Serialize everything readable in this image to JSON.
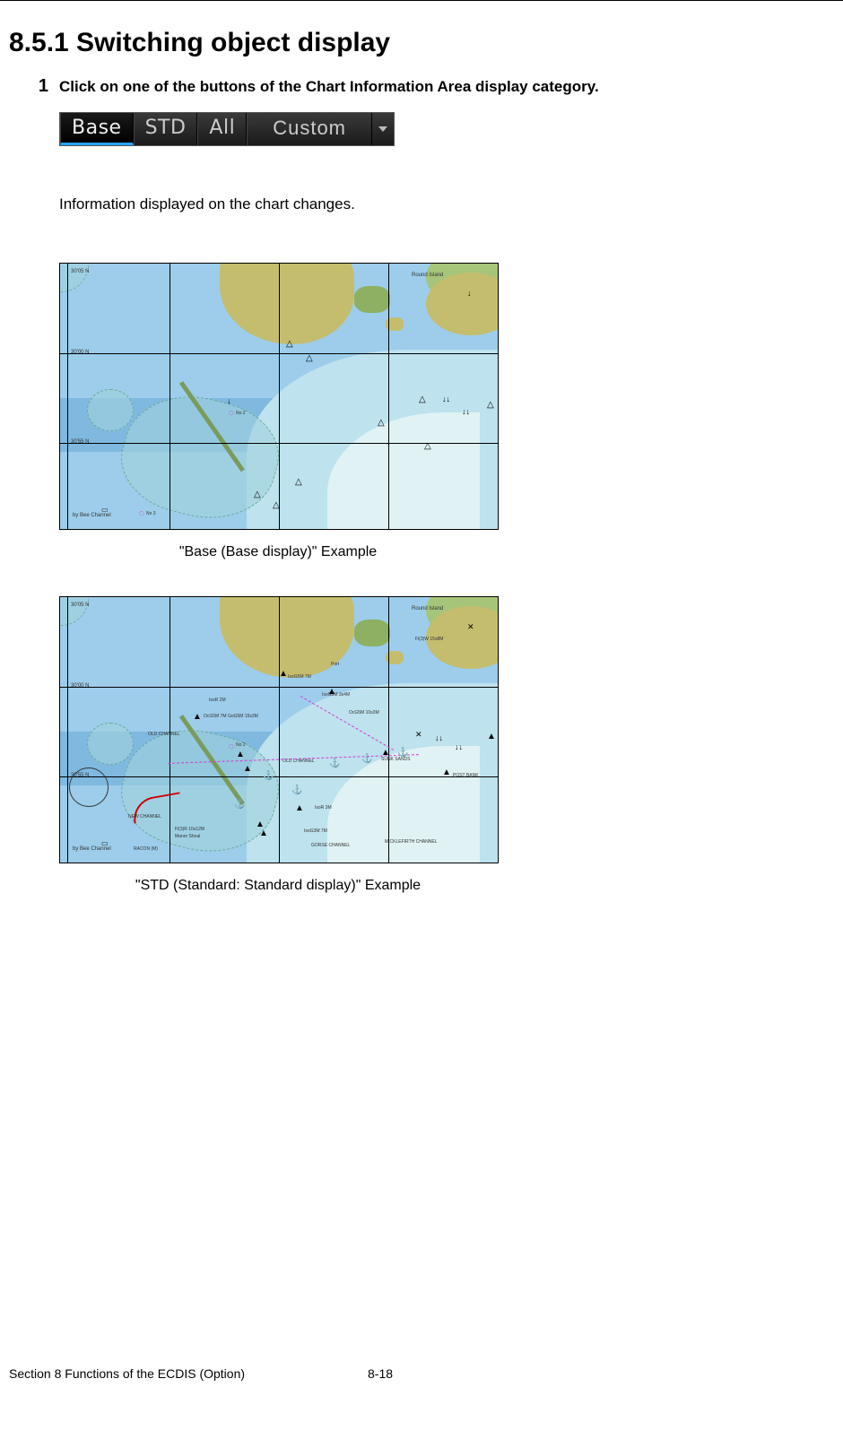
{
  "heading": "8.5.1    Switching object display",
  "step": {
    "number": "1",
    "instruction": "Click on one of the buttons of the Chart Information Area display category."
  },
  "buttons": {
    "base": "Base",
    "std": "STD",
    "all": "All",
    "custom": "Custom"
  },
  "info_text": "Information displayed on the chart changes.",
  "figure1": {
    "caption": "\"Base (Base display)\" Example",
    "labels": {
      "island": "Round Island",
      "channel": "by Bee Channel",
      "buoy_no2": "No 2",
      "buoy_no3": "No 3"
    }
  },
  "figure2": {
    "caption": "\"STD (Standard: Standard display)\" Example",
    "labels": {
      "island": "Round Island",
      "channel_old": "OLD CHANNEL",
      "channel_mid": "MICKLEFIRTH CHANNEL",
      "pier": "Port",
      "light1": "Fl(3)W 15s8M",
      "light2": "IsoG5M 7M",
      "light3": "IsoG5M 3s4M",
      "light4": "OcG5M 7M GoG5M 15s3M",
      "light5": "IsoR 2M",
      "light6": "OcG5M 10s3M",
      "light7": "Fl(3)R 10s12M",
      "light8": "IsoR 3M",
      "light9": "IsoG3M 7M",
      "new_ch": "NEW CHANNEL",
      "area1": "SUNK SANDS",
      "pt": "POST BANK",
      "by_bee": "by Bee Channel",
      "no2": "No 2",
      "racon": "RACON (M)",
      "shoal": "Manor Shoal",
      "gorse": "GORSE CHANNEL"
    }
  },
  "footer": {
    "section": "Section 8    Functions of the ECDIS (Option)",
    "page": "8-18"
  }
}
